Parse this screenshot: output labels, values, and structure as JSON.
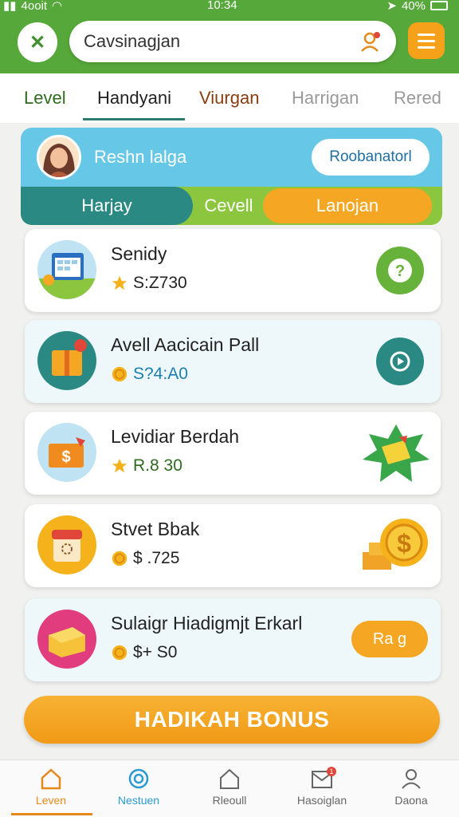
{
  "status": {
    "carrier": "4ooit",
    "time": "10:34",
    "battery": "40%"
  },
  "search": {
    "value": "Cavsinagjan"
  },
  "tabs": [
    {
      "label": "Level",
      "color": "#2e6b1f"
    },
    {
      "label": "Handyani",
      "color": "#222222"
    },
    {
      "label": "Viurgan",
      "color": "#8a3d10"
    },
    {
      "label": "Harrigan",
      "color": "#9a9a9a"
    },
    {
      "label": "Rered",
      "color": "#9a9a9a"
    }
  ],
  "profile": {
    "name": "Reshn lalga",
    "button_label": "Roobanatorl",
    "segments": {
      "left": "Harjay",
      "middle": "Cevell",
      "right": "Lanojan"
    }
  },
  "rewards": [
    {
      "title": "Senidy",
      "value": "S:Z730",
      "value_color": "#222222",
      "icon": "star-icon",
      "action": "question-icon"
    },
    {
      "title": "Avell Aacicain Pall",
      "value": "S?4:A0",
      "value_color": "#1a7fb0",
      "icon": "coin-icon",
      "action": "refresh-icon"
    },
    {
      "title": "Levidiar Berdah",
      "value": "R.8 30",
      "value_color": "#2e6b1f",
      "icon": "star-icon",
      "action": "cheese-burst-icon"
    },
    {
      "title": "Stvet Bbak",
      "value": "$ .725",
      "value_color": "#222222",
      "icon": "coin-icon",
      "action": "gold-coin-icon"
    },
    {
      "title": "Sulaigr Hiadigmjt Erkarl",
      "value": "$+ S0",
      "value_color": "#222222",
      "icon": "coin-icon",
      "action": "redeem-button",
      "action_label": "Ra g"
    }
  ],
  "bonus_label": "HADIKAH BONUS",
  "nav": [
    {
      "label": "Leven",
      "icon": "home-icon",
      "active": true
    },
    {
      "label": "Nestuen",
      "icon": "target-icon",
      "active": false
    },
    {
      "label": "Rleoull",
      "icon": "house-icon",
      "active": false
    },
    {
      "label": "Hasoiglan",
      "icon": "mail-icon",
      "active": false,
      "badge": "1"
    },
    {
      "label": "Daona",
      "icon": "user-icon",
      "active": false
    }
  ],
  "colors": {
    "header_green": "#56a83a",
    "accent_orange": "#f5a623",
    "teal": "#2a8a83"
  }
}
